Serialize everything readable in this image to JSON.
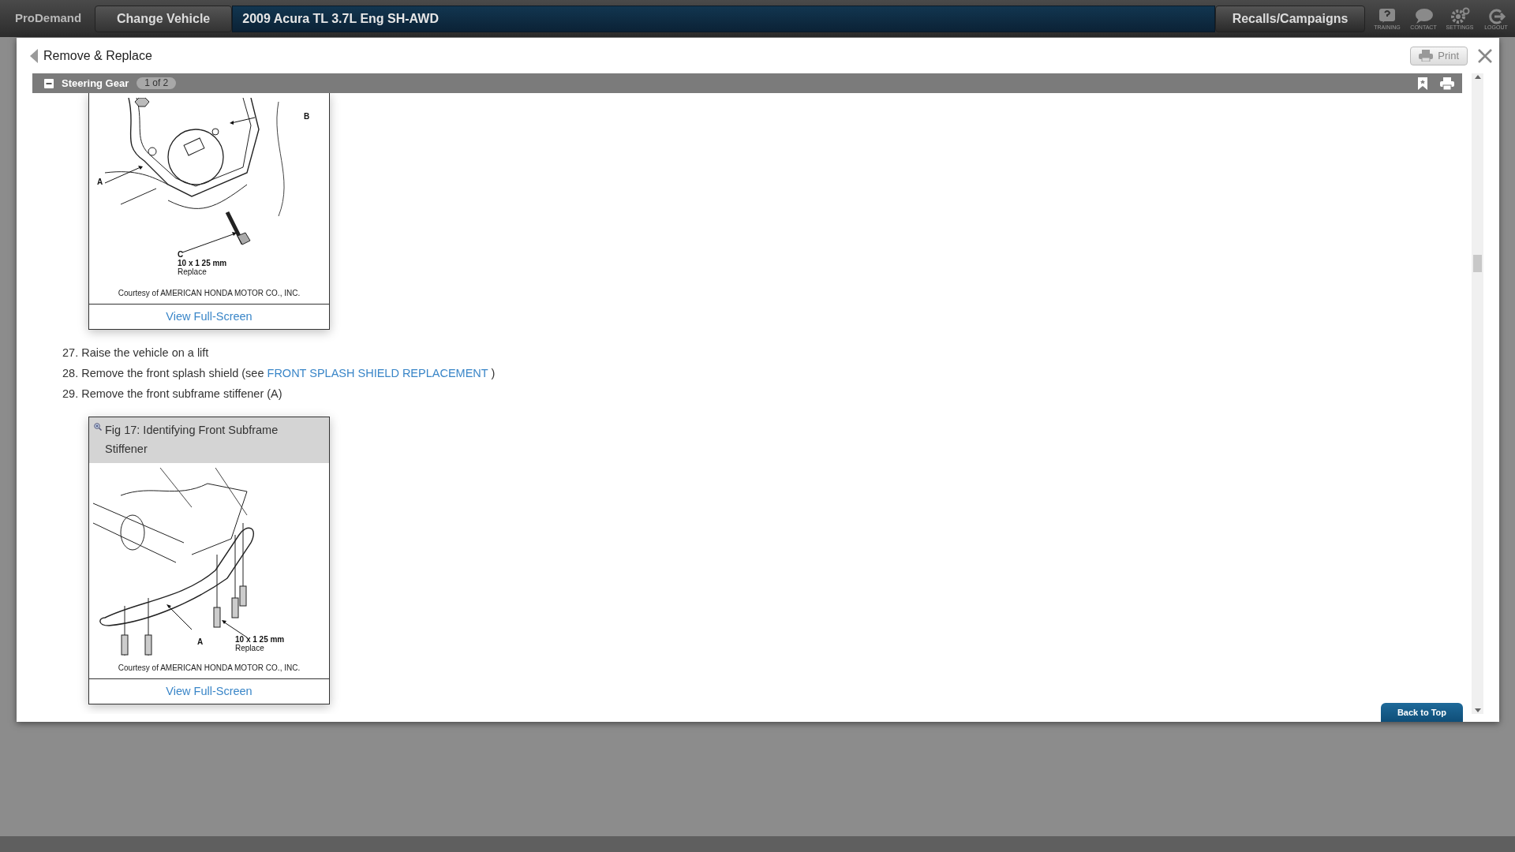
{
  "top_bar": {
    "brand": "ProDemand",
    "change_vehicle": "Change Vehicle",
    "vehicle": "2009 Acura TL 3.7L Eng SH-AWD",
    "recalls": "Recalls/Campaigns",
    "tools": [
      {
        "kind": "help",
        "label": "TRAINING"
      },
      {
        "kind": "chat",
        "label": "CONTACT"
      },
      {
        "kind": "gear",
        "label": "SETTINGS"
      },
      {
        "kind": "logout",
        "label": "LOGOUT"
      }
    ]
  },
  "panel": {
    "title": "Remove & Replace",
    "print": "Print"
  },
  "section": {
    "title": "Steering Gear",
    "expanded": true,
    "count": "1 of 2"
  },
  "content": [
    {
      "kind": "figure",
      "callouts": [
        "A",
        "B",
        "C",
        "10 x 1 25 mm",
        "Replace"
      ],
      "credit": "Courtesy of AMERICAN HONDA MOTOR CO., INC.",
      "link": "View Full-Screen"
    },
    {
      "kind": "step",
      "number": "27.",
      "text": "Raise the vehicle on a lift"
    },
    {
      "kind": "step",
      "number": "28.",
      "text": "Remove the front splash shield (see ",
      "link": "FRONT SPLASH SHIELD REPLACEMENT",
      "after": " )"
    },
    {
      "kind": "step",
      "number": "29.",
      "text": "Remove the front subframe stiffener (A)"
    },
    {
      "kind": "figure",
      "title": "Fig 17: Identifying Front Subframe Stiffener",
      "callouts": [
        "A",
        "10 x 1 25 mm",
        "Replace"
      ],
      "credit": "Courtesy of AMERICAN HONDA MOTOR CO., INC.",
      "link": "View Full-Screen"
    }
  ],
  "back_to_top": "Back to Top"
}
